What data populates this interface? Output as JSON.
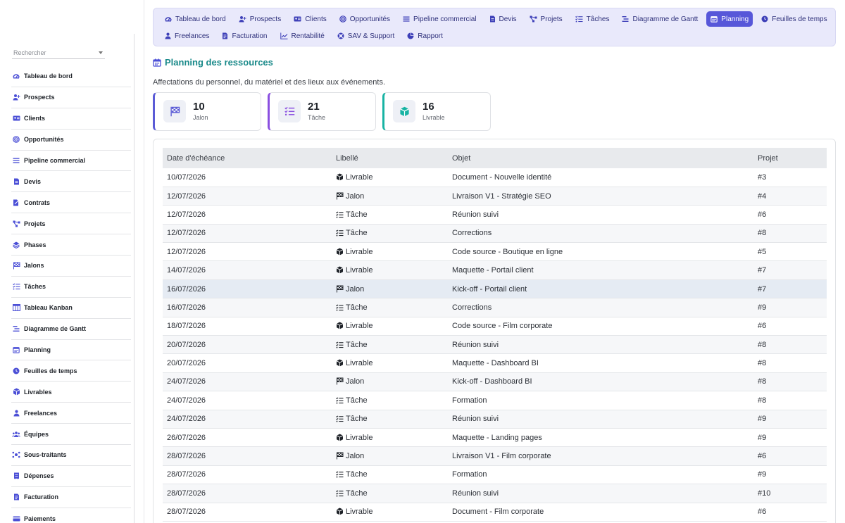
{
  "search": {
    "placeholder": "Rechercher"
  },
  "sidebar": {
    "items": [
      {
        "label": "Tableau de bord",
        "icon": "dashboard-icon"
      },
      {
        "label": "Prospects",
        "icon": "user-plus-icon"
      },
      {
        "label": "Clients",
        "icon": "id-card-icon"
      },
      {
        "label": "Opportunités",
        "icon": "target-icon"
      },
      {
        "label": "Pipeline commercial",
        "icon": "bars-icon"
      },
      {
        "label": "Devis",
        "icon": "document-icon"
      },
      {
        "label": "Contrats",
        "icon": "contract-icon"
      },
      {
        "label": "Projets",
        "icon": "project-icon"
      },
      {
        "label": "Phases",
        "icon": "layers-icon"
      },
      {
        "label": "Jalons",
        "icon": "flag-icon"
      },
      {
        "label": "Tâches",
        "icon": "tasks-icon"
      },
      {
        "label": "Tableau Kanban",
        "icon": "kanban-icon"
      },
      {
        "label": "Diagramme de Gantt",
        "icon": "gantt-icon"
      },
      {
        "label": "Planning",
        "icon": "calendar-icon"
      },
      {
        "label": "Feuilles de temps",
        "icon": "clock-icon"
      },
      {
        "label": "Livrables",
        "icon": "box-icon"
      },
      {
        "label": "Freelances",
        "icon": "person-icon"
      },
      {
        "label": "Équipes",
        "icon": "team-icon"
      },
      {
        "label": "Sous-traitants",
        "icon": "network-icon"
      },
      {
        "label": "Dépenses",
        "icon": "receipt-icon"
      },
      {
        "label": "Facturation",
        "icon": "invoice-icon"
      },
      {
        "label": "Paiements",
        "icon": "payment-icon"
      }
    ]
  },
  "topnav": {
    "row1": [
      {
        "label": "Tableau de bord",
        "icon": "dashboard-icon"
      },
      {
        "label": "Prospects",
        "icon": "user-plus-icon"
      },
      {
        "label": "Clients",
        "icon": "id-card-icon"
      },
      {
        "label": "Opportunités",
        "icon": "target-icon"
      },
      {
        "label": "Pipeline commercial",
        "icon": "bars-icon"
      },
      {
        "label": "Devis",
        "icon": "document-icon"
      },
      {
        "label": "Projets",
        "icon": "project-icon"
      },
      {
        "label": "Tâches",
        "icon": "tasks-icon"
      },
      {
        "label": "Diagramme de Gantt",
        "icon": "gantt-icon"
      },
      {
        "label": "Planning",
        "icon": "calendar-icon",
        "active": true
      },
      {
        "label": "Feuilles de temps",
        "icon": "clock-icon"
      }
    ],
    "row2": [
      {
        "label": "Freelances",
        "icon": "person-icon"
      },
      {
        "label": "Facturation",
        "icon": "invoice-icon"
      },
      {
        "label": "Rentabilité",
        "icon": "chart-icon"
      },
      {
        "label": "SAV & Support",
        "icon": "support-icon"
      },
      {
        "label": "Rapport",
        "icon": "pie-icon"
      }
    ]
  },
  "header": {
    "title": "Planning des ressources",
    "subtitle": "Affectations du personnel, du matériel et des lieux aux événements."
  },
  "stats": [
    {
      "value": "10",
      "label": "Jalon",
      "color": "#5b5bd6",
      "icon": "flag-icon"
    },
    {
      "value": "21",
      "label": "Tâche",
      "color": "#8a4fe0",
      "icon": "tasks-icon"
    },
    {
      "value": "16",
      "label": "Livrable",
      "color": "#17b3a3",
      "icon": "box-icon"
    }
  ],
  "table": {
    "headers": [
      "Date d'échéance",
      "Libellé",
      "Objet",
      "Projet"
    ],
    "rows": [
      {
        "date": "10/07/2026",
        "type": "Livrable",
        "object": "Document - Nouvelle identité",
        "project": "#3"
      },
      {
        "date": "12/07/2026",
        "type": "Jalon",
        "object": "Livraison V1 - Stratégie SEO",
        "project": "#4"
      },
      {
        "date": "12/07/2026",
        "type": "Tâche",
        "object": "Réunion suivi",
        "project": "#6"
      },
      {
        "date": "12/07/2026",
        "type": "Tâche",
        "object": "Corrections",
        "project": "#8"
      },
      {
        "date": "12/07/2026",
        "type": "Livrable",
        "object": "Code source - Boutique en ligne",
        "project": "#5"
      },
      {
        "date": "14/07/2026",
        "type": "Livrable",
        "object": "Maquette - Portail client",
        "project": "#7"
      },
      {
        "date": "16/07/2026",
        "type": "Jalon",
        "object": "Kick-off - Portail client",
        "project": "#7",
        "highlight": true
      },
      {
        "date": "16/07/2026",
        "type": "Tâche",
        "object": "Corrections",
        "project": "#9"
      },
      {
        "date": "18/07/2026",
        "type": "Livrable",
        "object": "Code source - Film corporate",
        "project": "#6"
      },
      {
        "date": "20/07/2026",
        "type": "Tâche",
        "object": "Réunion suivi",
        "project": "#8"
      },
      {
        "date": "20/07/2026",
        "type": "Livrable",
        "object": "Maquette - Dashboard BI",
        "project": "#8"
      },
      {
        "date": "24/07/2026",
        "type": "Jalon",
        "object": "Kick-off - Dashboard BI",
        "project": "#8"
      },
      {
        "date": "24/07/2026",
        "type": "Tâche",
        "object": "Formation",
        "project": "#8"
      },
      {
        "date": "24/07/2026",
        "type": "Tâche",
        "object": "Réunion suivi",
        "project": "#9"
      },
      {
        "date": "26/07/2026",
        "type": "Livrable",
        "object": "Maquette - Landing pages",
        "project": "#9"
      },
      {
        "date": "28/07/2026",
        "type": "Jalon",
        "object": "Livraison V1 - Film corporate",
        "project": "#6"
      },
      {
        "date": "28/07/2026",
        "type": "Tâche",
        "object": "Formation",
        "project": "#9"
      },
      {
        "date": "28/07/2026",
        "type": "Tâche",
        "object": "Réunion suivi",
        "project": "#10"
      },
      {
        "date": "28/07/2026",
        "type": "Livrable",
        "object": "Document - Film corporate",
        "project": "#6"
      }
    ]
  },
  "colors": {
    "accent": "#5757d9",
    "title": "#1a8a8a",
    "nav_bg": "#e9e9fb"
  }
}
